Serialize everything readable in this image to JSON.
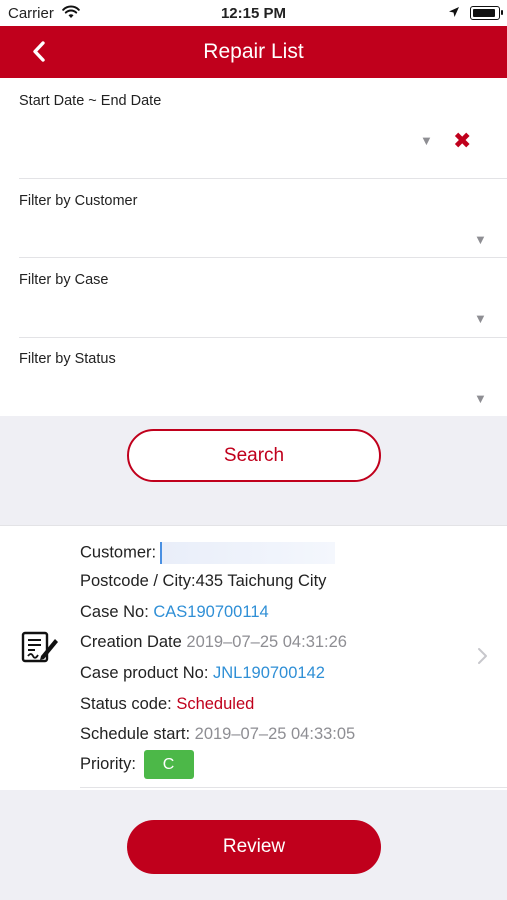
{
  "status_bar": {
    "carrier": "Carrier",
    "time": "12:15 PM",
    "battery_level": 0.95
  },
  "nav": {
    "title": "Repair List"
  },
  "filters": [
    {
      "label": "Start Date ~ End Date",
      "value": "",
      "has_clear": true
    },
    {
      "label": "Filter by Customer",
      "value": ""
    },
    {
      "label": "Filter by Case",
      "value": ""
    },
    {
      "label": "Filter by Status",
      "value": ""
    }
  ],
  "search_button": "Search",
  "record": {
    "customer_label": "Customer:",
    "postcode_label": "Postcode / City:",
    "postcode_value": "435 Taichung City",
    "case_no_label": "Case No:",
    "case_no_value": "CAS190700114",
    "creation_date_label": "Creation Date",
    "creation_date_value": "2019–07–25 04:31:26",
    "case_product_label": "Case product No:",
    "case_product_value": "JNL190700142",
    "status_code_label": "Status code:",
    "status_code_value": "Scheduled",
    "schedule_start_label": "Schedule start:",
    "schedule_start_value": "2019–07–25 04:33:05",
    "priority_label": "Priority:",
    "priority_value": "C"
  },
  "review_button": "Review",
  "colors": {
    "brand_red": "#c0001c",
    "link_blue": "#2f8fd6",
    "priority_green": "#4cb848"
  },
  "icons": [
    "wifi-icon",
    "location-arrow-icon",
    "battery-icon",
    "back-chevron-icon",
    "dropdown-caret-icon",
    "clear-icon",
    "document-sign-icon",
    "chevron-right-icon"
  ]
}
